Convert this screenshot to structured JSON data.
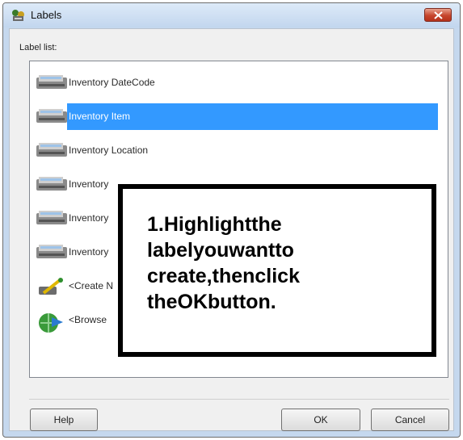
{
  "window": {
    "title": "Labels"
  },
  "list_label": "Label list:",
  "items": [
    {
      "label": "Inventory DateCode",
      "icon": "label-printer-icon",
      "selected": false
    },
    {
      "label": "Inventory Item",
      "icon": "label-printer-icon",
      "selected": true
    },
    {
      "label": "Inventory Location",
      "icon": "label-printer-icon",
      "selected": false
    },
    {
      "label": "Inventory",
      "icon": "label-printer-icon",
      "selected": false
    },
    {
      "label": "Inventory",
      "icon": "label-printer-icon",
      "selected": false
    },
    {
      "label": "Inventory",
      "icon": "label-printer-icon",
      "selected": false
    },
    {
      "label": "<Create N",
      "icon": "create-wand-icon",
      "selected": false
    },
    {
      "label": "<Browse",
      "icon": "browse-globe-icon",
      "selected": false
    }
  ],
  "overlay_text": "1.Highlightthe\nlabelyouwantto\ncreate,thenclick\ntheOKbutton.",
  "buttons": {
    "help": "Help",
    "ok": "OK",
    "cancel": "Cancel"
  },
  "colors": {
    "selection": "#3399ff",
    "titlebar": "#c5d8ee",
    "close": "#c6452d"
  }
}
